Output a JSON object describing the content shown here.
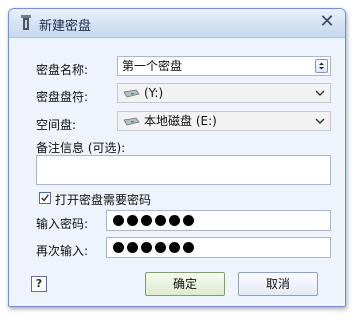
{
  "window": {
    "title": "新建密盘",
    "close_symbol": "✕",
    "title_icon": "app-icon",
    "close_icon": "close-icon"
  },
  "form": {
    "disk_name_label": "密盘名称:",
    "disk_name_value": "第一个密盘",
    "drive_letter_label": "密盘盘符:",
    "drive_letter_value": "(Y:)",
    "space_disk_label": "空间盘:",
    "space_disk_value": "本地磁盘 (E:)",
    "note_label": "备注信息 (可选):",
    "note_value": "",
    "require_password_label": "打开密盘需要密码",
    "require_password_checked": true,
    "password_label": "输入密码:",
    "password_mask_count": 6,
    "confirm_label": "再次输入:",
    "confirm_mask_count": 6
  },
  "buttons": {
    "help": "?",
    "ok": "确定",
    "cancel": "取消"
  },
  "colors": {
    "title_bar": "#d3e0f4",
    "window_bg": "#eff3fb",
    "default_button": "#dcebd0"
  }
}
